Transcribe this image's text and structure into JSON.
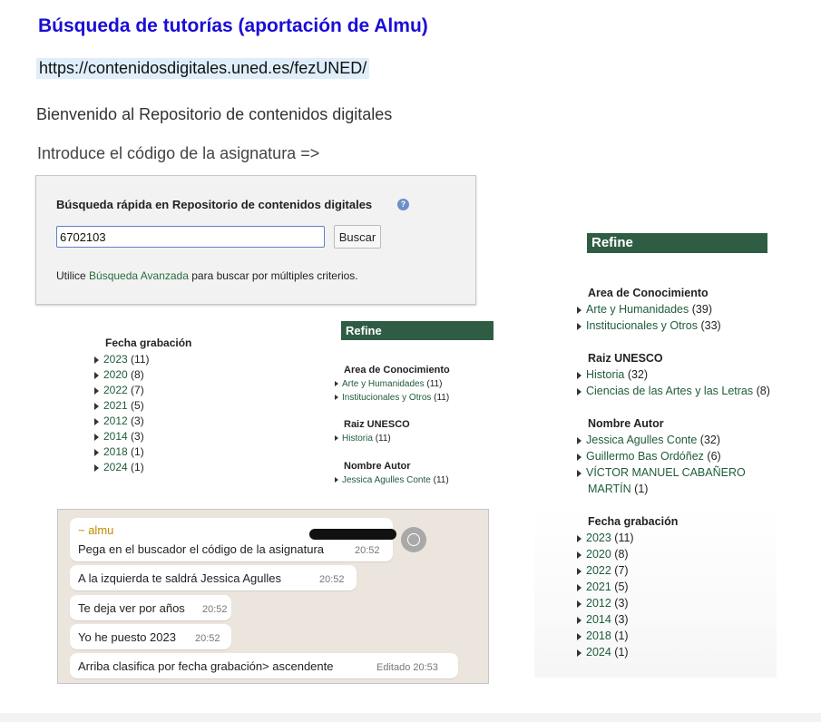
{
  "header": {
    "title": "Búsqueda de tutorías (aportación de Almu)",
    "url": "https://contenidosdigitales.uned.es/fezUNED/",
    "welcome": "Bienvenido al Repositorio de contenidos digitales",
    "intro": "Introduce el código de la asignatura =>"
  },
  "search": {
    "title": "Búsqueda rápida en Repositorio de contenidos digitales",
    "help_icon": "question-icon",
    "value": "6702103",
    "button": "Buscar",
    "note_before": "Utilice ",
    "note_link": "Búsqueda Avanzada",
    "note_after": " para buscar por múltiples criterios."
  },
  "fecha_small": {
    "heading": "Fecha grabación",
    "items": [
      {
        "year": "2023",
        "count": "(11)"
      },
      {
        "year": "2020",
        "count": "(8)"
      },
      {
        "year": "2022",
        "count": "(7)"
      },
      {
        "year": "2021",
        "count": "(5)"
      },
      {
        "year": "2012",
        "count": "(3)"
      },
      {
        "year": "2014",
        "count": "(3)"
      },
      {
        "year": "2018",
        "count": "(1)"
      },
      {
        "year": "2024",
        "count": "(1)"
      }
    ]
  },
  "refine_mid": {
    "title": "Refine",
    "area_heading": "Area de Conocimiento",
    "area_items": [
      {
        "label": "Arte y Humanidades",
        "count": "(11)"
      },
      {
        "label": "Institucionales y Otros",
        "count": "(11)"
      }
    ],
    "unesco_heading": "Raiz UNESCO",
    "unesco_items": [
      {
        "label": "Historia",
        "count": "(11)"
      }
    ],
    "autor_heading": "Nombre Autor",
    "autor_items": [
      {
        "label": "Jessica Agulles Conte",
        "count": "(11)"
      }
    ]
  },
  "chat": {
    "sender": "~ almu",
    "messages": [
      {
        "text": "Pega en el buscador el código de la asignatura",
        "time": "20:52"
      },
      {
        "text": "A la izquierda te saldrá Jessica Agulles",
        "time": "20:52"
      },
      {
        "text": "Te deja ver por años",
        "time": "20:52"
      },
      {
        "text": "Yo he puesto 2023",
        "time": "20:52"
      },
      {
        "text": "Arriba clasifica por fecha grabación> ascendente",
        "time": "Editado  20:53"
      }
    ],
    "emoji_icon": "emoji-icon"
  },
  "refine_right": {
    "title": "Refine",
    "area_heading": "Area de Conocimiento",
    "area_items": [
      {
        "label": "Arte y Humanidades",
        "count": "(39)"
      },
      {
        "label": "Institucionales y Otros",
        "count": "(33)"
      }
    ],
    "unesco_heading": "Raiz UNESCO",
    "unesco_items": [
      {
        "label": "Historia",
        "count": "(32)"
      },
      {
        "label": "Ciencias de las Artes y las Letras",
        "count": "(8)"
      }
    ],
    "autor_heading": "Nombre Autor",
    "autor_items": [
      {
        "label": "Jessica Agulles Conte",
        "count": "(32)"
      },
      {
        "label": "Guillermo Bas Ordóñez",
        "count": "(6)"
      },
      {
        "label": "VÍCTOR MANUEL CABAÑERO",
        "label2": "MARTÍN",
        "count": "(1)"
      }
    ],
    "fecha_heading": "Fecha grabación",
    "fecha_items": [
      {
        "year": "2023",
        "count": "(11)"
      },
      {
        "year": "2020",
        "count": "(8)"
      },
      {
        "year": "2022",
        "count": "(7)"
      },
      {
        "year": "2021",
        "count": "(5)"
      },
      {
        "year": "2012",
        "count": "(3)"
      },
      {
        "year": "2014",
        "count": "(3)"
      },
      {
        "year": "2018",
        "count": "(1)"
      },
      {
        "year": "2024",
        "count": "(1)"
      }
    ]
  },
  "colors": {
    "title": "#1a0dd6",
    "refine_bar": "#2f5d44",
    "link": "#1f5c3a",
    "chat_bg": "#ece5dd",
    "sender": "#c28a00"
  }
}
